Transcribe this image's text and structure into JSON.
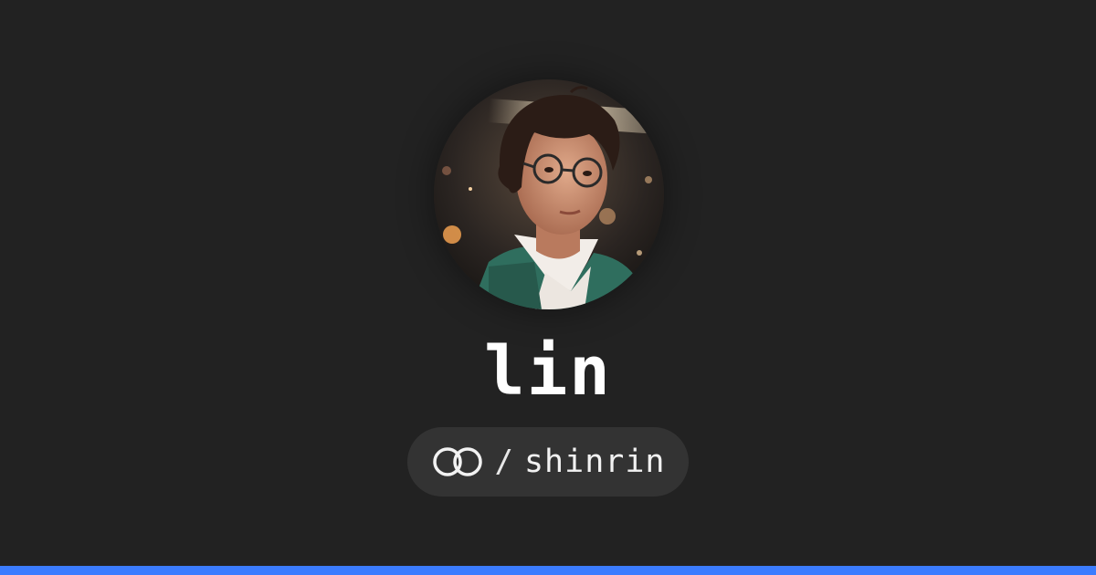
{
  "profile": {
    "name": "lin",
    "separator": "/",
    "handle": "shinrin"
  },
  "icons": {
    "avatar": "avatar-portrait",
    "logo": "interlocking-circles-logo"
  },
  "colors": {
    "background": "#222222",
    "pill": "#333333",
    "text": "#ffffff",
    "accent_bar": "#3b7cff"
  }
}
